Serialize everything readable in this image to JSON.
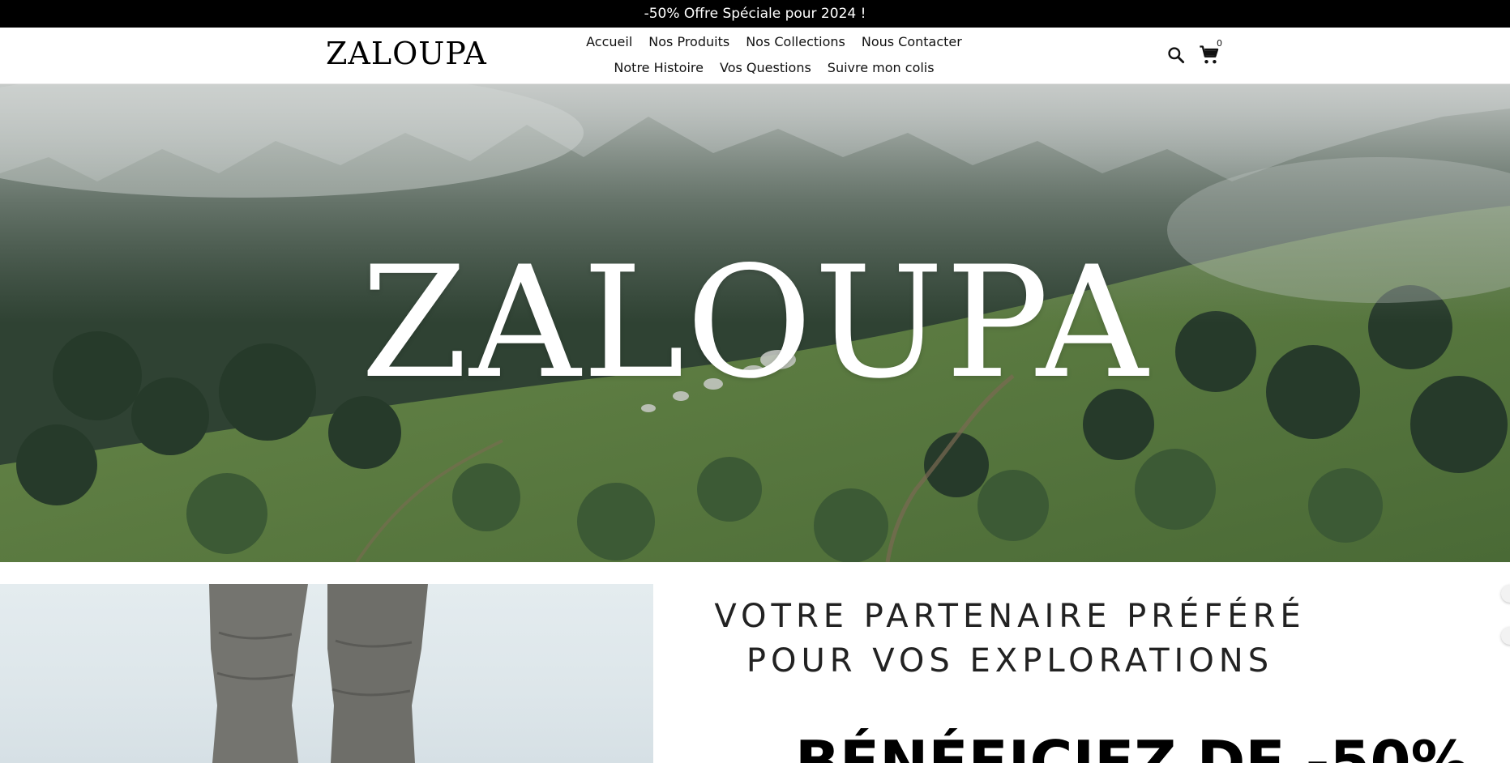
{
  "announcement": {
    "text": "-50% Offre Spéciale pour 2024 !"
  },
  "header": {
    "logo": "ZALOUPA",
    "nav": [
      {
        "label": "Accueil"
      },
      {
        "label": "Nos Produits"
      },
      {
        "label": "Nos Collections"
      },
      {
        "label": "Nous Contacter"
      },
      {
        "label": "Notre Histoire"
      },
      {
        "label": "Vos Questions"
      },
      {
        "label": "Suivre mon colis"
      }
    ],
    "cart_count": "0",
    "icons": {
      "search": "search-icon",
      "cart": "cart-icon"
    }
  },
  "hero": {
    "title": "ZALOUPA"
  },
  "promo": {
    "tagline_line1": "VOTRE PARTENAIRE PRÉFÉRÉ",
    "tagline_line2": "POUR VOS EXPLORATIONS",
    "headline": "BÉNÉFICIEZ DE -50%"
  },
  "colors": {
    "announcement_bg": "#000000",
    "text": "#111111",
    "hero_text": "#ffffff"
  }
}
